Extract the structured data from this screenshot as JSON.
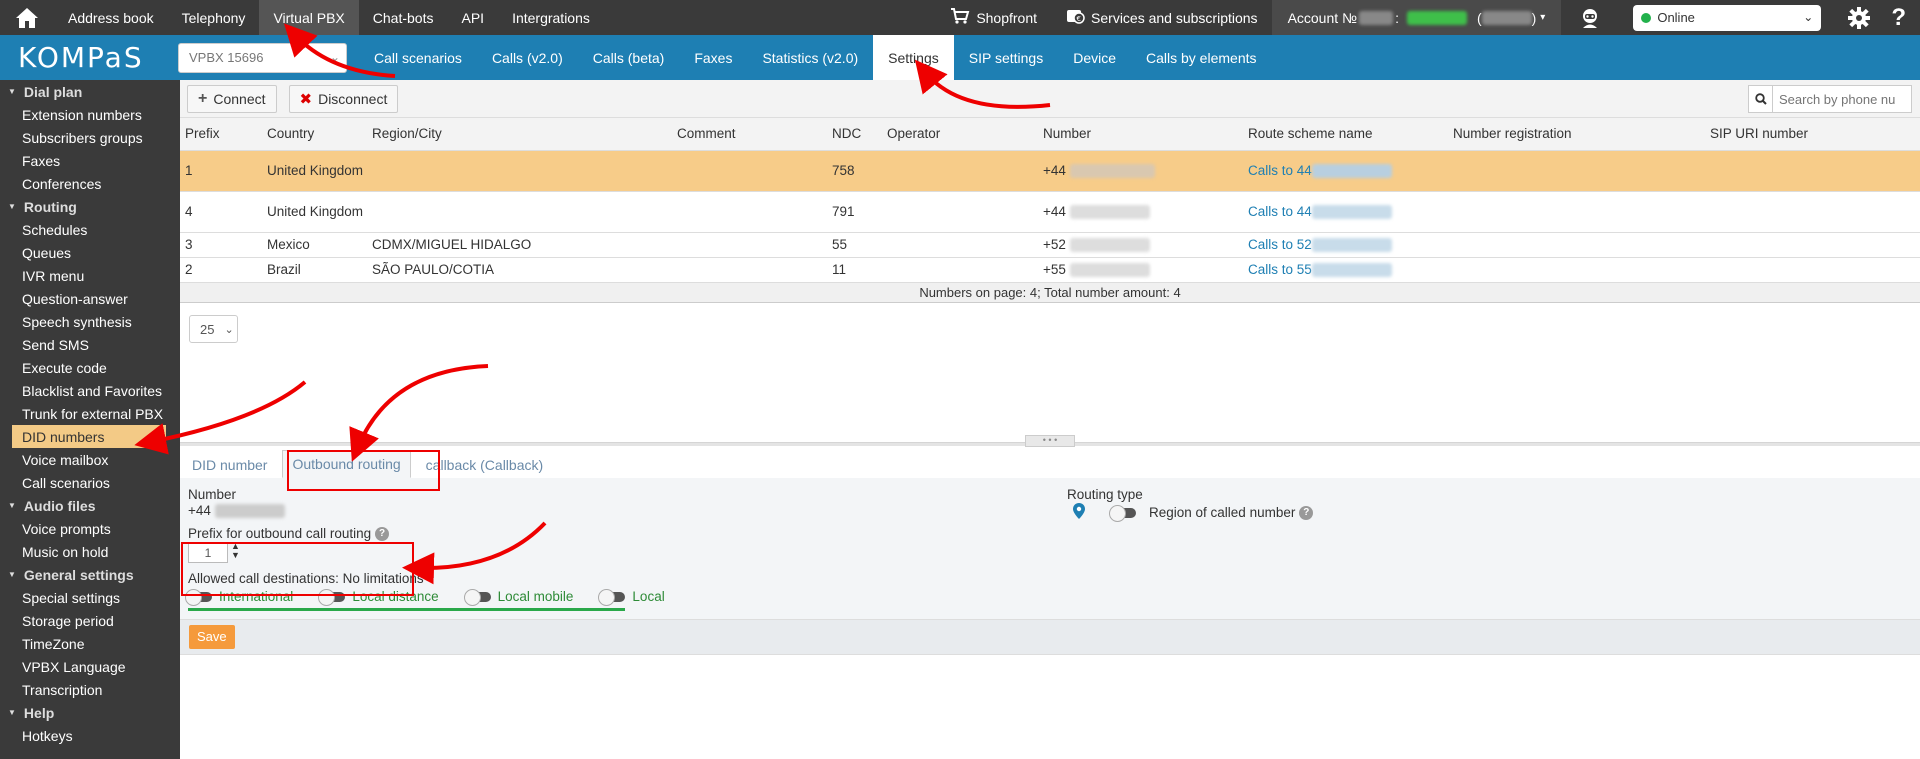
{
  "top_nav": {
    "items": [
      "Address book",
      "Telephony",
      "Virtual PBX",
      "Chat-bots",
      "API",
      "Intergrations"
    ],
    "active_index": 2,
    "shopfront": "Shopfront",
    "services": "Services and subscriptions",
    "account_label": "Account №",
    "status": "Online"
  },
  "second_nav": {
    "logo": "KOMPaS",
    "vpbx_select": "VPBX 15696",
    "items": [
      "Call scenarios",
      "Calls (v2.0)",
      "Calls (beta)",
      "Faxes",
      "Statistics (v2.0)",
      "Settings",
      "SIP settings",
      "Device",
      "Calls by elements"
    ],
    "active_index": 5
  },
  "sidebar": {
    "sections": [
      {
        "title": "Dial plan",
        "items": [
          "Extension numbers",
          "Subscribers groups",
          "Faxes",
          "Conferences"
        ]
      },
      {
        "title": "Routing",
        "items": [
          "Schedules",
          "Queues",
          "IVR menu",
          "Question-answer",
          "Speech synthesis",
          "Send SMS",
          "Execute code",
          "Blacklist and Favorites",
          "Trunk for external PBX",
          "DID numbers",
          "Voice mailbox",
          "Call scenarios"
        ]
      },
      {
        "title": "Audio files",
        "items": [
          "Voice prompts",
          "Music on hold"
        ]
      },
      {
        "title": "General settings",
        "items": [
          "Special settings",
          "Storage period",
          "TimeZone",
          "VPBX Language",
          "Transcription"
        ]
      },
      {
        "title": "Help",
        "items": [
          "Hotkeys"
        ]
      }
    ],
    "active_item": "DID numbers"
  },
  "toolbar": {
    "connect": "Connect",
    "disconnect": "Disconnect",
    "search_placeholder": "Search by phone nu"
  },
  "table": {
    "columns": [
      "Prefix",
      "Country",
      "Region/City",
      "Comment",
      "NDC",
      "Operator",
      "Number",
      "Route scheme name",
      "Number registration",
      "SIP URI number"
    ],
    "rows": [
      {
        "prefix": "1",
        "country": "United Kingdom",
        "region": "",
        "comment": "",
        "ndc": "758",
        "operator": "",
        "number": "+44",
        "route": "Calls to 44",
        "selected": true
      },
      {
        "prefix": "4",
        "country": "United Kingdom",
        "region": "",
        "comment": "",
        "ndc": "791",
        "operator": "",
        "number": "+44",
        "route": "Calls to 44",
        "selected": false
      },
      {
        "prefix": "3",
        "country": "Mexico",
        "region": "CDMX/MIGUEL HIDALGO",
        "comment": "",
        "ndc": "55",
        "operator": "",
        "number": "+52",
        "route": "Calls to 52",
        "selected": false
      },
      {
        "prefix": "2",
        "country": "Brazil",
        "region": "SÃO PAULO/COTIA",
        "comment": "",
        "ndc": "11",
        "operator": "",
        "number": "+55",
        "route": "Calls to 55",
        "selected": false
      }
    ],
    "footer": "Numbers on page: 4; Total number amount: 4",
    "page_size": "25"
  },
  "detail_tabs": [
    "DID number",
    "Outbound routing",
    "callback (Callback)"
  ],
  "detail": {
    "number_label": "Number",
    "number_value": "+44",
    "routing_type_label": "Routing type",
    "region_label": "Region of called number",
    "prefix_label": "Prefix for outbound call routing",
    "prefix_value": "1",
    "allowed_label": "Allowed call destinations: No limitations",
    "destinations": [
      "International",
      "Local distance",
      "Local mobile",
      "Local"
    ],
    "save": "Save"
  },
  "colors": {
    "topbar": "#3a3a3a",
    "brand_blue": "#1e7fb3",
    "selected_row": "#f7cc89",
    "save": "#f59a3c",
    "annotation_red": "#e00000"
  }
}
